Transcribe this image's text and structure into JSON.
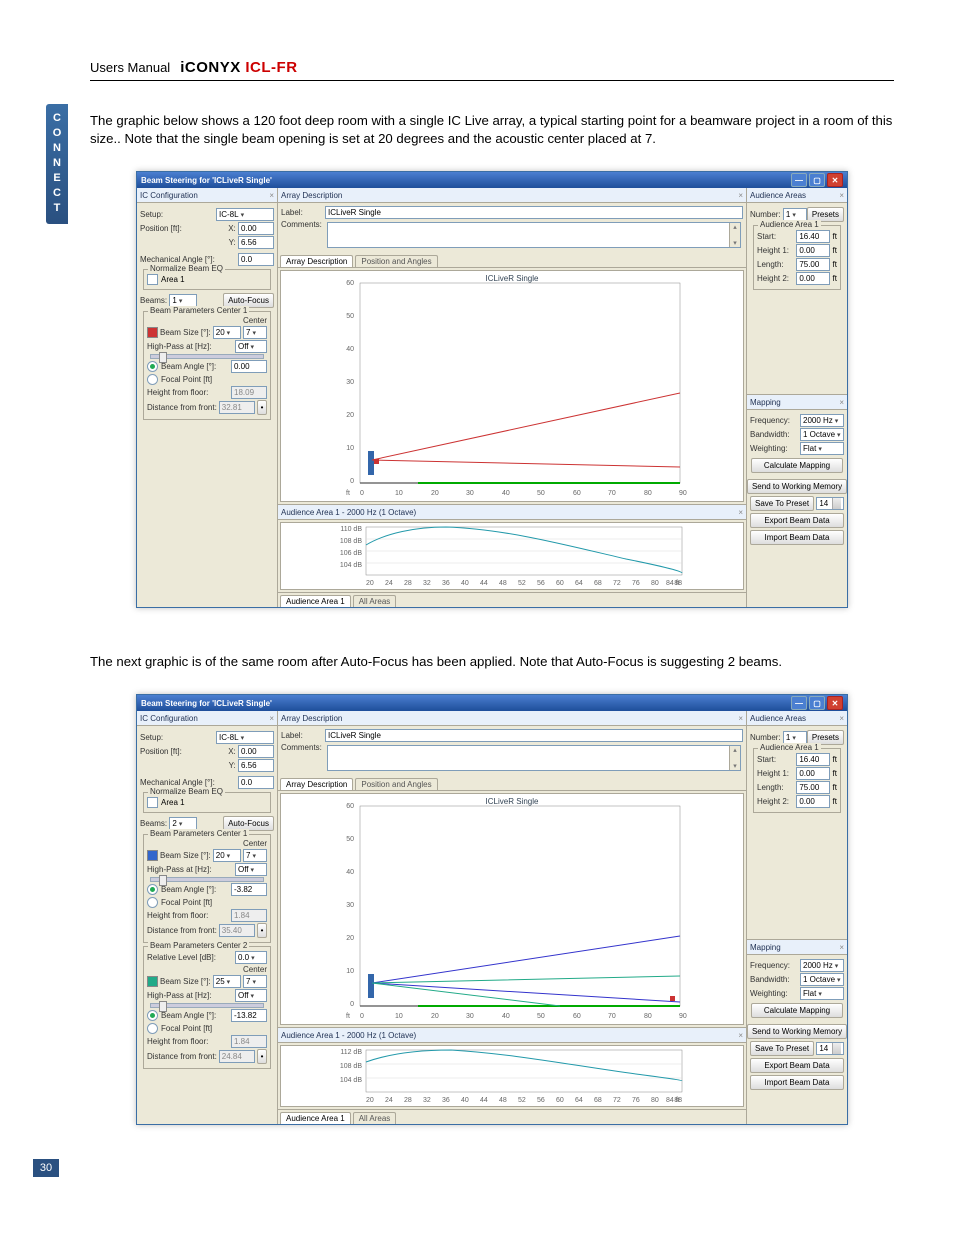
{
  "header": {
    "users_manual": "Users Manual",
    "brand_black": "iCONYX",
    "brand_red": " ICL-FR"
  },
  "side": {
    "label": "CONNECT"
  },
  "page_number": "30",
  "para1": "The graphic below shows a 120 foot deep room with a single IC Live array, a typical starting point for a beamware project in a room of this size.. Note that the single beam opening is set at 20 degrees and the acoustic center placed at 7.",
  "para2": "The next graphic is of the same room after Auto-Focus has been applied. Note that Auto-Focus is suggesting 2 beams.",
  "win": {
    "title": "Beam Steering for 'ICLiveR Single'",
    "ic_conf": "IC Configuration",
    "array_desc": "Array Description",
    "aud_areas": "Audience Areas",
    "label_lbl": "Label:",
    "label_val": "ICLiveR Single",
    "comments_lbl": "Comments:",
    "tab_ad": "Array Description",
    "tab_pa": "Position and Angles",
    "plot_title": "ICLiveR Single",
    "spl_title": "Audience Area 1 - 2000 Hz (1 Octave)",
    "bottab1": "Audience Area 1",
    "bottab2": "All Areas",
    "setup_lbl": "Setup:",
    "setup_val": "IC-8L",
    "pos_lbl": "Position [ft]:",
    "pos_x_lbl": "X:",
    "pos_x": "0.00",
    "pos_y_lbl": "Y:",
    "pos_y": "6.56",
    "mech_lbl": "Mechanical Angle [°]:",
    "mech_val": "0.0",
    "neq_lbl": "Normalize Beam EQ",
    "neq_area": "Area 1",
    "beams_lbl": "Beams:",
    "beams_val_1": "1",
    "beams_val_2": "2",
    "af_btn": "Auto-Focus",
    "bp1_lbl": "Beam Parameters Center 1",
    "bp2_lbl": "Beam Parameters Center 2",
    "center_lbl": "Center",
    "bsize_lbl": "Beam Size [°]:",
    "bsize_val": "20",
    "bsize_val_b": "25",
    "bcenter_val": "7",
    "hp_lbl": "High-Pass at [Hz]:",
    "hp_val": "Off",
    "bang_lbl": "Beam Angle [°]:",
    "bang_val": "0.00",
    "bang_val_2a": "-3.82",
    "bang_val_2b": "-13.82",
    "fp_lbl": "Focal Point [ft]",
    "hff_lbl": "Height from floor:",
    "hff_val": "18.09",
    "hff_val_2a": "1.84",
    "hff_val_2b": "1.84",
    "dff_lbl": "Distance from front:",
    "dff_val": "32.81",
    "dff_val_2a": "35.40",
    "dff_val_2b": "24.84",
    "rl_lbl": "Relative Level [dB]:",
    "rl_val": "0.0",
    "num_lbl": "Number:",
    "num_val": "1",
    "presets_btn": "Presets",
    "aa1_lbl": "Audience Area 1",
    "start_lbl": "Start:",
    "start_val": "16.40",
    "unit_ft": "ft",
    "h1_lbl": "Height 1:",
    "h1_val": "0.00",
    "len_lbl": "Length:",
    "len_val": "75.00",
    "h2_lbl": "Height 2:",
    "h2_val": "0.00",
    "map_lbl": "Mapping",
    "freq_lbl": "Frequency:",
    "freq_val": "2000 Hz",
    "bw_lbl": "Bandwidth:",
    "bw_val": "1 Octave",
    "wt_lbl": "Weighting:",
    "wt_val": "Flat",
    "calc_btn": "Calculate Mapping",
    "swm_btn": "Send to Working Memory",
    "stp_btn": "Save To Preset",
    "stp_val": "14",
    "ebd_btn": "Export Beam Data",
    "ibd_btn": "Import Beam Data"
  },
  "chart_data": [
    {
      "id": "s1_room",
      "type": "line",
      "title": "ICLiveR Single",
      "xlabel": "ft",
      "ylim": [
        0,
        60
      ],
      "xlim": [
        0,
        90
      ],
      "xticks": [
        0,
        10,
        20,
        30,
        40,
        50,
        60,
        70,
        80,
        90
      ],
      "yticks": [
        0,
        10,
        20,
        30,
        40,
        50,
        60
      ],
      "array_marker": {
        "x": 3,
        "y": 7
      },
      "beams": [
        {
          "center_y": 7,
          "open_deg": 20,
          "color": "#c33"
        }
      ],
      "floor": [
        {
          "x": 0,
          "y": 0
        },
        {
          "x": 16.4,
          "y": 0
        },
        {
          "x": 90,
          "y": 0
        }
      ],
      "audience": {
        "start": 16.4,
        "length": 75,
        "h1": 0,
        "h2": 0
      }
    },
    {
      "id": "s1_spl",
      "type": "line",
      "title": "Audience Area 1 - 2000 Hz (1 Octave)",
      "xlabel": "ft",
      "xlim": [
        20,
        88
      ],
      "xticks": [
        20,
        24,
        28,
        32,
        36,
        40,
        44,
        48,
        52,
        56,
        60,
        64,
        68,
        72,
        76,
        80,
        84,
        88
      ],
      "ylabel": "dB",
      "ylim": [
        104,
        110
      ],
      "yticks": [
        104,
        106,
        108,
        110
      ],
      "series": [
        {
          "name": "SPL",
          "values": [
            107,
            108.5,
            109.5,
            110,
            110,
            109.6,
            109,
            108.2,
            107.6,
            107,
            106.4,
            105.9,
            105.4,
            105,
            104.6,
            104.3,
            104.1,
            104
          ]
        }
      ]
    },
    {
      "id": "s2_room",
      "type": "line",
      "title": "ICLiveR Single",
      "xlabel": "ft",
      "ylim": [
        0,
        60
      ],
      "xlim": [
        0,
        90
      ],
      "xticks": [
        0,
        10,
        20,
        30,
        40,
        50,
        60,
        70,
        80,
        90
      ],
      "yticks": [
        0,
        10,
        20,
        30,
        40,
        50,
        60
      ],
      "array_marker": {
        "x": 3,
        "y": 7
      },
      "audience_point": {
        "x": 88,
        "y": 1.8
      },
      "beams": [
        {
          "center_y": 7,
          "open_deg": 25,
          "angle": -3.82,
          "color": "#33c"
        },
        {
          "center_y": 7,
          "open_deg": 25,
          "angle": -13.82,
          "color": "#29a"
        }
      ],
      "floor": [
        {
          "x": 0,
          "y": 0
        },
        {
          "x": 16.4,
          "y": 0
        },
        {
          "x": 90,
          "y": 0
        }
      ]
    },
    {
      "id": "s2_spl",
      "type": "line",
      "title": "Audience Area 1 - 2000 Hz (1 Octave)",
      "xlabel": "ft",
      "xlim": [
        20,
        88
      ],
      "xticks": [
        20,
        24,
        28,
        32,
        36,
        40,
        44,
        48,
        52,
        56,
        60,
        64,
        68,
        72,
        76,
        80,
        84,
        88
      ],
      "ylabel": "dB",
      "ylim": [
        104,
        112
      ],
      "yticks": [
        104,
        108,
        112
      ],
      "series": [
        {
          "name": "SPL",
          "values": [
            109,
            110.5,
            111.5,
            112,
            111.8,
            111.2,
            110.5,
            109.8,
            109.1,
            108.5,
            108,
            107.5,
            107.1,
            106.8,
            106.5,
            106.3,
            106.1,
            106
          ]
        }
      ]
    }
  ]
}
